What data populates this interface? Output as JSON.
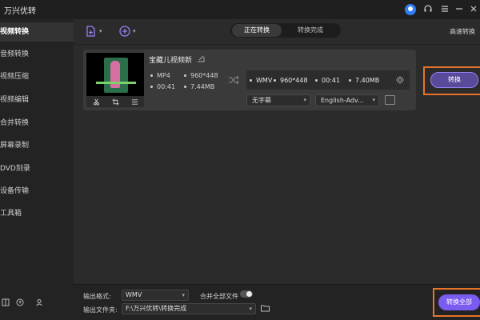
{
  "app": {
    "title": "万兴优转"
  },
  "titlebar": {
    "icons": [
      "user-avatar-icon",
      "headset-icon",
      "menu-icon",
      "minimize-icon",
      "close-icon"
    ]
  },
  "sidebar": {
    "items": [
      {
        "label": "视频转换",
        "active": true
      },
      {
        "label": "音频转换",
        "active": false
      },
      {
        "label": "视频压缩",
        "active": false
      },
      {
        "label": "视频编辑",
        "active": false
      },
      {
        "label": "合并转换",
        "active": false
      },
      {
        "label": "屏幕录制",
        "active": false
      },
      {
        "label": "DVD刻录",
        "active": false
      },
      {
        "label": "设备传输",
        "active": false
      },
      {
        "label": "工具箱",
        "active": false
      }
    ],
    "bottom_icons": [
      "book-icon",
      "help-icon",
      "account-icon"
    ]
  },
  "toolbar": {
    "tabs": [
      {
        "label": "正在转换",
        "active": true
      },
      {
        "label": "转换完成",
        "active": false
      }
    ],
    "fast_label": "高速转换"
  },
  "file": {
    "name": "宝藏儿视频新",
    "source": {
      "format": "MP4",
      "resolution": "960*448",
      "duration": "00:41",
      "size": "7.44MB"
    },
    "output": {
      "format": "WMV",
      "resolution": "960*448",
      "duration": "00:41",
      "size": "7.40MB"
    },
    "subtitle": "无字幕",
    "audio": "English-Adv...",
    "convert_label": "转换"
  },
  "bottom": {
    "output_format_label": "输出格式:",
    "output_format_value": "WMV",
    "merge_label": "合并全部文件",
    "output_folder_label": "输出文件夹:",
    "output_folder_value": "F:\\万兴优转\\转换完成",
    "convert_all_label": "转换全部"
  },
  "colors": {
    "accent": "#7b5cf0",
    "highlight": "#e8742a",
    "avatar": "#2f7df6"
  }
}
